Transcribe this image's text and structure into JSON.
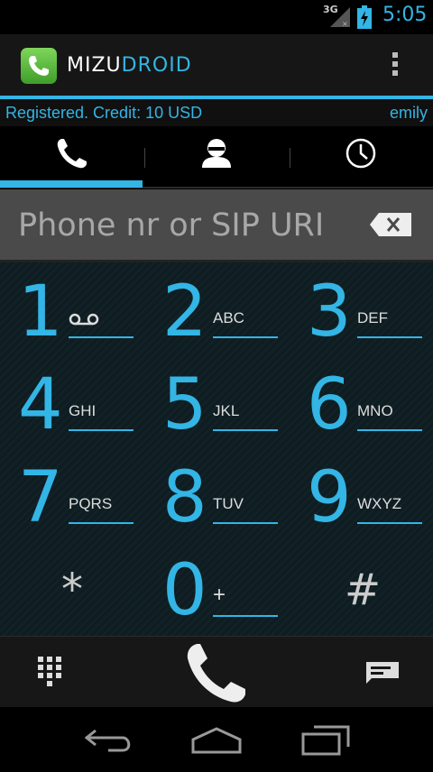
{
  "status_bar": {
    "network": "3G",
    "time": "5:05"
  },
  "app": {
    "title_part1": "MIZU",
    "title_part2": "DROID"
  },
  "registration": {
    "status": "Registered. Credit: 10 USD",
    "user": "emily"
  },
  "tabs": [
    {
      "icon": "phone-icon"
    },
    {
      "icon": "contact-icon"
    },
    {
      "icon": "clock-icon"
    }
  ],
  "input": {
    "placeholder": "Phone nr or SIP URI",
    "value": ""
  },
  "keypad": {
    "keys": [
      {
        "digit": "1",
        "letters": ""
      },
      {
        "digit": "2",
        "letters": "ABC"
      },
      {
        "digit": "3",
        "letters": "DEF"
      },
      {
        "digit": "4",
        "letters": "GHI"
      },
      {
        "digit": "5",
        "letters": "JKL"
      },
      {
        "digit": "6",
        "letters": "MNO"
      },
      {
        "digit": "7",
        "letters": "PQRS"
      },
      {
        "digit": "8",
        "letters": "TUV"
      },
      {
        "digit": "9",
        "letters": "WXYZ"
      },
      {
        "digit": "*",
        "letters": ""
      },
      {
        "digit": "0",
        "letters": "+"
      },
      {
        "digit": "#",
        "letters": ""
      }
    ]
  },
  "colors": {
    "accent": "#33b5e5",
    "keypad_bg": "#0e1d22"
  }
}
